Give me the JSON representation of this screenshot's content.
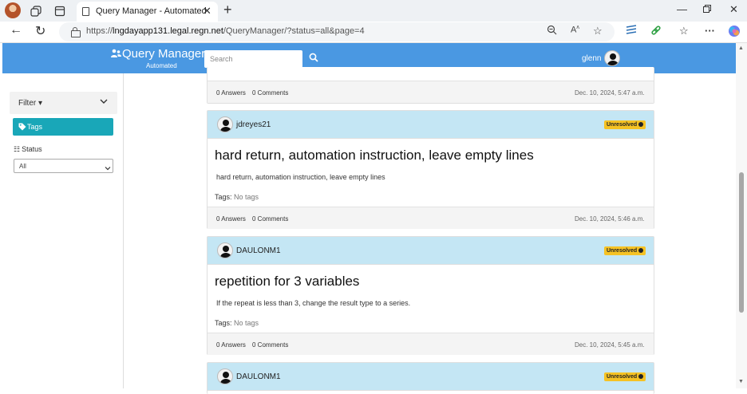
{
  "browser": {
    "tab_title": "Query Manager - Automated",
    "url_prefix": "https://",
    "url_host": "lngdayapp131.legal.regn.net",
    "url_path": "/QueryManager/?status=all&page=4"
  },
  "app": {
    "brand_name": "Query Manager",
    "brand_sub": "Automated",
    "search_placeholder": "Search",
    "user_name": "glenn"
  },
  "sidebar": {
    "filter_label": "Filter ▾",
    "tags_label": "Tags",
    "status_label": "Status",
    "status_value": "All"
  },
  "top_partial": {
    "answers": "0 Answers",
    "comments": "0 Comments",
    "date": "Dec. 10, 2024, 5:47 a.m."
  },
  "queries": [
    {
      "author": "jdreyes21",
      "status": "Unresolved",
      "title": "hard return, automation instruction, leave empty lines",
      "body": "hard return, automation instruction, leave empty lines",
      "tags_label": "Tags:",
      "tags_value": "No tags",
      "answers": "0 Answers",
      "comments": "0 Comments",
      "date": "Dec. 10, 2024, 5:46 a.m."
    },
    {
      "author": "DAULONM1",
      "status": "Unresolved",
      "title": "repetition for 3 variables",
      "body": "If the repeat is less than 3, change the result type to a series.",
      "tags_label": "Tags:",
      "tags_value": "No tags",
      "answers": "0 Answers",
      "comments": "0 Comments",
      "date": "Dec. 10, 2024, 5:45 a.m."
    },
    {
      "author": "DAULONM1",
      "status": "Unresolved"
    }
  ]
}
